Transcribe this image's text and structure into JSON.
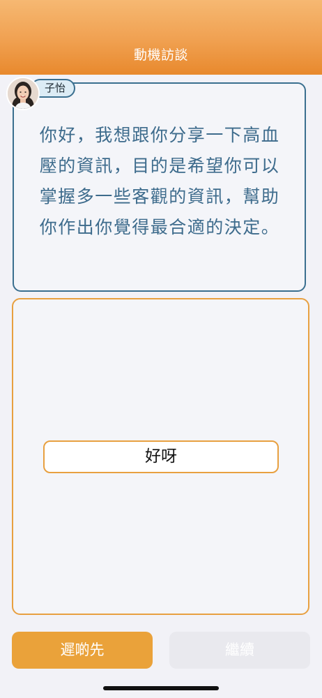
{
  "header": {
    "title": "動機訪談"
  },
  "speaker": {
    "name": "子怡",
    "avatar_icon": "woman-portrait-icon"
  },
  "message": {
    "text": "你好，我想跟你分享一下高血壓的資訊，目的是希望你可以掌握多一些客觀的資訊，幫助你作出你覺得最合適的決定。"
  },
  "choices": [
    {
      "label": "好呀"
    }
  ],
  "footer": {
    "later_label": "遲啲先",
    "continue_label": "繼續"
  },
  "colors": {
    "header_gradient_top": "#f6b872",
    "header_gradient_bottom": "#e8892d",
    "accent_blue": "#3a6f8f",
    "accent_orange": "#e8a040",
    "later_button": "#eaa23a",
    "disabled_button": "#e9e9ee"
  }
}
